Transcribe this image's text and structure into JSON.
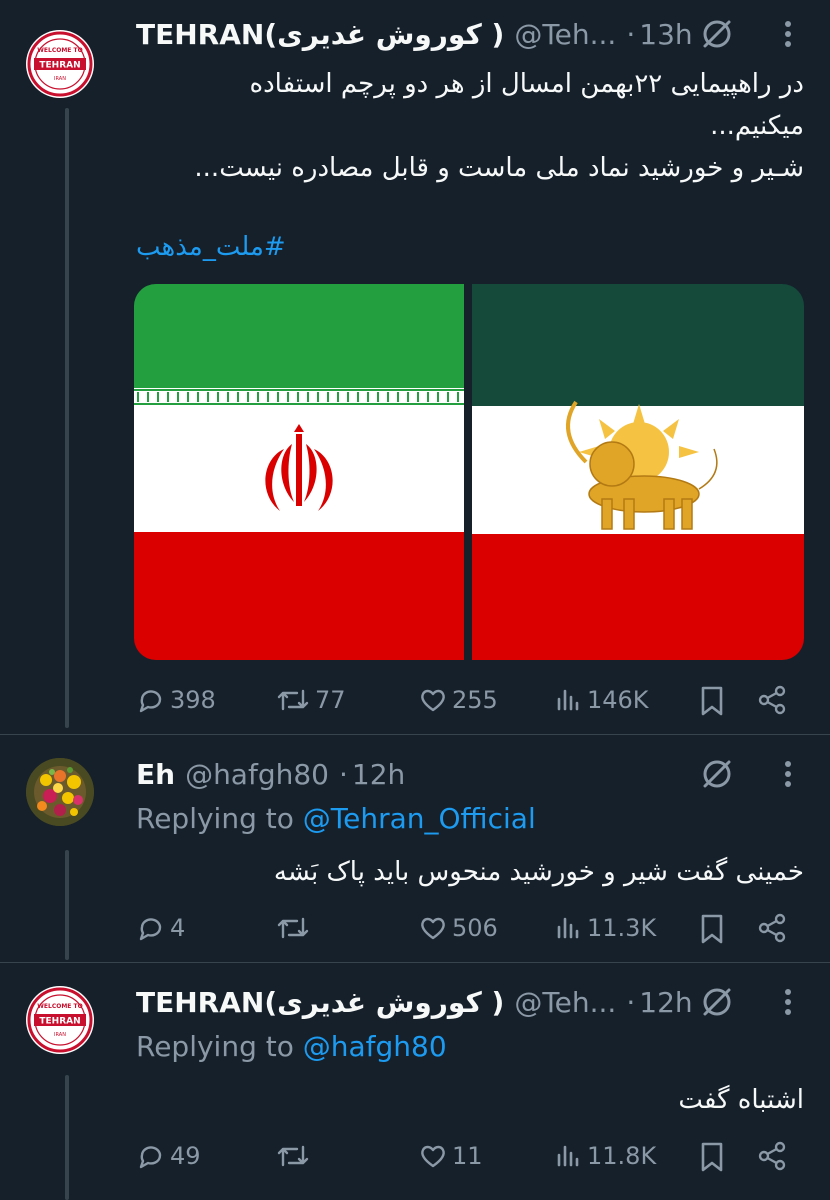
{
  "tweets": [
    {
      "author": "TEHRAN(کوروش غدیری )",
      "handle": "@Teh...",
      "dot": "·",
      "time": "13h",
      "text_line1": "در راهپیمایی ۲۲بهمن امسال از هر دو پرچم استفاده",
      "text_line2": "میکنیم...",
      "text_line3": "شـیر و خورشید نماد ملی ماست و قابل مصادره نیست...",
      "hashtag": "#ملت_مذهب",
      "replies": "398",
      "reposts": "77",
      "likes": "255",
      "views": "146K",
      "avatar": {
        "top_text": "WELCOME TO",
        "banner": "TEHRAN",
        "bottom_text": "IRAN"
      }
    },
    {
      "author": "Eh",
      "handle": "@hafgh80",
      "dot": "·",
      "time": "12h",
      "replying_prefix": "Replying to",
      "replying_to": "@Tehran_Official",
      "text_line1": "خمینی گفت شیر و خورشید منحوس باید پاک بَشه",
      "replies": "4",
      "reposts": "",
      "likes": "506",
      "views": "11.3K"
    },
    {
      "author": "TEHRAN(کوروش غدیری )",
      "handle": "@Teh...",
      "dot": "·",
      "time": "12h",
      "replying_prefix": "Replying to",
      "replying_to": "@hafgh80",
      "text_line1": "اشتباه گفت",
      "replies": "49",
      "reposts": "",
      "likes": "11",
      "views": "11.8K",
      "avatar": {
        "top_text": "WELCOME TO",
        "banner": "TEHRAN",
        "bottom_text": "IRAN"
      }
    }
  ],
  "colors": {
    "background": "#15202b",
    "text": "#f7f9f9",
    "secondary": "#8b98a5",
    "link": "#1d9bf0",
    "divider": "#38444d"
  },
  "icons": [
    "grok-icon",
    "more-icon",
    "reply-icon",
    "repost-icon",
    "like-icon",
    "views-icon",
    "bookmark-icon",
    "share-icon"
  ]
}
